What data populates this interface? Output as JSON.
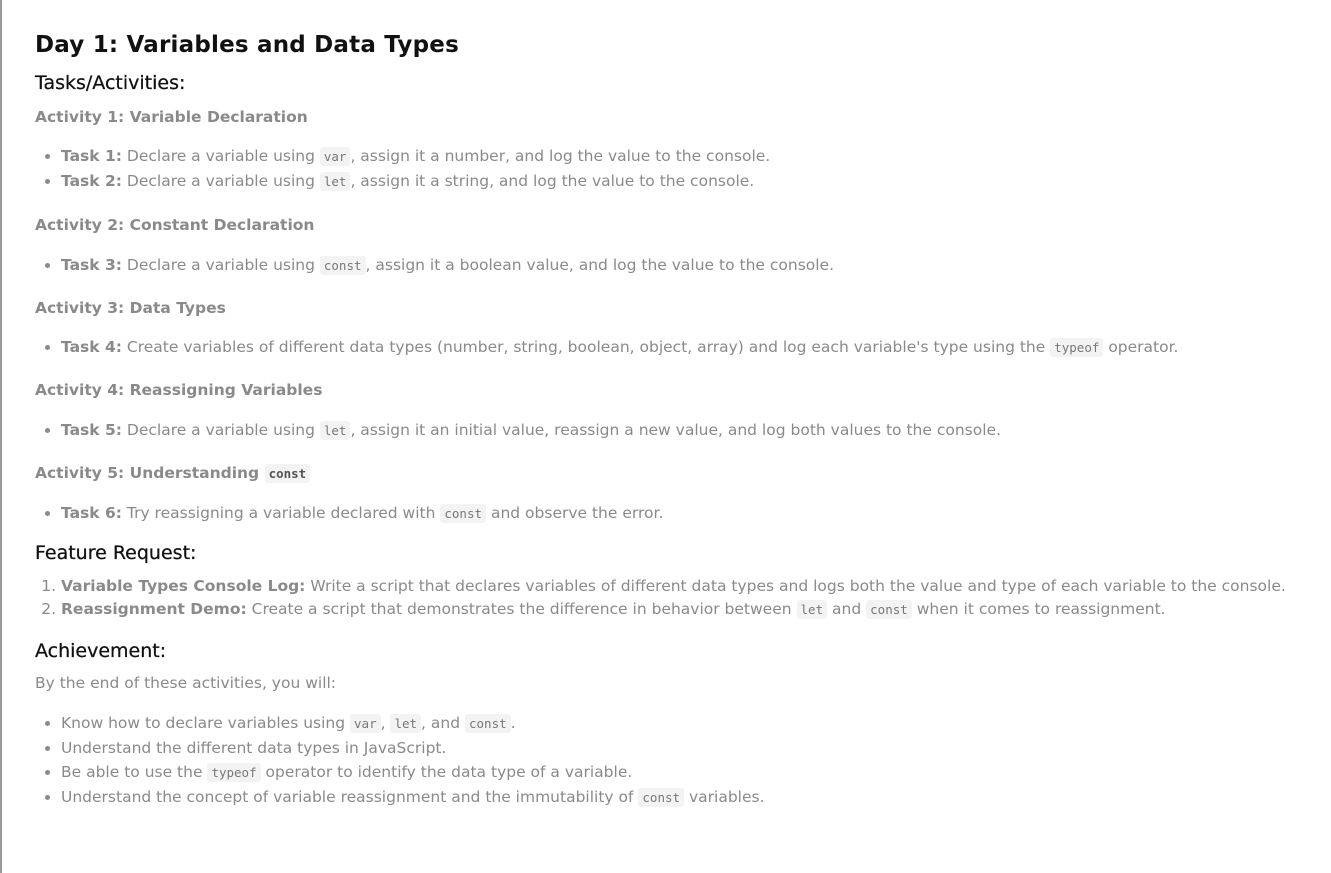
{
  "title": "Day 1: Variables and Data Types",
  "tasks_heading": "Tasks/Activities:",
  "activity1": {
    "heading": "Activity 1: Variable Declaration",
    "task1": {
      "label": "Task 1:",
      "pre": "Declare a variable using",
      "code": "var",
      "post": ", assign it a number, and log the value to the console."
    },
    "task2": {
      "label": "Task 2:",
      "pre": "Declare a variable using",
      "code": "let",
      "post": ", assign it a string, and log the value to the console."
    }
  },
  "activity2": {
    "heading": "Activity 2: Constant Declaration",
    "task3": {
      "label": "Task 3:",
      "pre": "Declare a variable using",
      "code": "const",
      "post": ", assign it a boolean value, and log the value to the console."
    }
  },
  "activity3": {
    "heading": "Activity 3: Data Types",
    "task4": {
      "label": "Task 4:",
      "pre": "Create variables of different data types (number, string, boolean, object, array) and log each variable's type using the",
      "code": "typeof",
      "post": "operator."
    }
  },
  "activity4": {
    "heading": "Activity 4: Reassigning Variables",
    "task5": {
      "label": "Task 5:",
      "pre": "Declare a variable using",
      "code": "let",
      "post": ", assign it an initial value, reassign a new value, and log both values to the console."
    }
  },
  "activity5": {
    "heading_text": "Activity 5: Understanding",
    "heading_code": "const",
    "task6": {
      "label": "Task 6:",
      "pre": "Try reassigning a variable declared with",
      "code": "const",
      "post": "and observe the error."
    }
  },
  "feature": {
    "heading": "Feature Request:",
    "item1": {
      "label": "Variable Types Console Log:",
      "text": "Write a script that declares variables of different data types and logs both the value and type of each variable to the console."
    },
    "item2": {
      "label": "Reassignment Demo:",
      "pre": "Create a script that demonstrates the difference in behavior between",
      "code1": "let",
      "mid": "and",
      "code2": "const",
      "post": "when it comes to reassignment."
    }
  },
  "achievement": {
    "heading": "Achievement:",
    "intro": "By the end of these activities, you will:",
    "item1": {
      "pre": "Know how to declare variables using",
      "code1": "var",
      "sep1": ",",
      "code2": "let",
      "sep2": ", and",
      "code3": "const",
      "post": "."
    },
    "item2": {
      "text": "Understand the different data types in JavaScript."
    },
    "item3": {
      "pre": "Be able to use the",
      "code": "typeof",
      "post": "operator to identify the data type of a variable."
    },
    "item4": {
      "pre": "Understand the concept of variable reassignment and the immutability of",
      "code": "const",
      "post": "variables."
    }
  }
}
